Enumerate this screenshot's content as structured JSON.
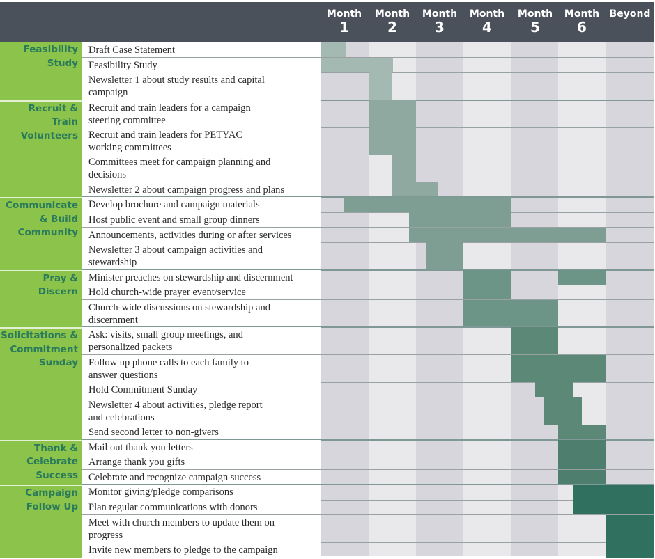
{
  "chart_data": {
    "type": "gantt",
    "title": "",
    "columns": [
      {
        "word": "Month",
        "num": "1"
      },
      {
        "word": "Month",
        "num": "2"
      },
      {
        "word": "Month",
        "num": "3"
      },
      {
        "word": "Month",
        "num": "4"
      },
      {
        "word": "Month",
        "num": "5"
      },
      {
        "word": "Month",
        "num": "6"
      },
      {
        "word": "Beyond",
        "num": ""
      }
    ],
    "x_unit": "months from campaign start (0 = start of Month 1, 6 = start of Beyond, 7 = end of Beyond)",
    "xlim": [
      0,
      7
    ],
    "groups": [
      {
        "label": "Feasibility Study",
        "color": "#a4b9b1",
        "tasks": [
          {
            "label": "Draft Case Statement",
            "spans": [
              [
                0,
                0.54
              ]
            ]
          },
          {
            "label": "Feasibility Study",
            "spans": [
              [
                0,
                1.52
              ]
            ]
          },
          {
            "label": "Newsletter 1 about study results and capital campaign",
            "spans": [
              [
                1.0,
                1.5
              ]
            ]
          }
        ]
      },
      {
        "label": "Recruit & Train Volunteers",
        "color": "#8fa9a1",
        "tasks": [
          {
            "label": "Recruit and train leaders for a campaign steering committee",
            "spans": [
              [
                1,
                2
              ]
            ]
          },
          {
            "label": "Recruit and train leaders for PETYAC working committees",
            "spans": [
              [
                1,
                2
              ]
            ]
          },
          {
            "label": "Committees meet for campaign planning and decisions",
            "spans": [
              [
                1.5,
                2
              ]
            ]
          },
          {
            "label": "Newsletter 2 about campaign progress and plans",
            "spans": [
              [
                1.5,
                2.45
              ]
            ]
          }
        ]
      },
      {
        "label": "Communicate & Build Community",
        "color": "#7e9e94",
        "tasks": [
          {
            "label": "Develop brochure and campaign materials",
            "spans": [
              [
                0.48,
                4
              ]
            ]
          },
          {
            "label": "Host public event and small group dinners",
            "spans": [
              [
                1.86,
                4
              ]
            ]
          },
          {
            "label": "Announcements, activities during or after services",
            "spans": [
              [
                1.86,
                6
              ]
            ]
          },
          {
            "label": "Newsletter 3 about campaign activities and stewardship",
            "spans": [
              [
                2.22,
                3
              ]
            ]
          }
        ]
      },
      {
        "label": "Pray & Discern",
        "color": "#6c9587",
        "tasks": [
          {
            "label": "Minister preaches on stewardship and discernment",
            "spans": [
              [
                3,
                4
              ],
              [
                5,
                6
              ]
            ]
          },
          {
            "label": "Hold church-wide prayer event/service",
            "spans": [
              [
                3,
                4
              ]
            ]
          },
          {
            "label": "Church-wide discussions on stewardship and discernment",
            "spans": [
              [
                3,
                5
              ]
            ]
          }
        ]
      },
      {
        "label": "Solicitations & Commitment Sunday",
        "color": "#5c8878",
        "tasks": [
          {
            "label": "Ask: visits, small group meetings, and personalized packets",
            "spans": [
              [
                4,
                5
              ]
            ]
          },
          {
            "label": "Follow up phone calls to each family to answer questions",
            "spans": [
              [
                4,
                6
              ]
            ]
          },
          {
            "label": "Hold Commitment Sunday",
            "spans": [
              [
                4.5,
                5.3
              ]
            ]
          },
          {
            "label": "Newsletter 4 about activities, pledge report and celebrations",
            "spans": [
              [
                4.7,
                5.5
              ]
            ]
          },
          {
            "label": "Send second letter to non-givers",
            "spans": [
              [
                5,
                6
              ]
            ]
          }
        ]
      },
      {
        "label": "Thank & Celebrate Success",
        "color": "#4e7f6e",
        "tasks": [
          {
            "label": "Mail out thank you letters",
            "spans": [
              [
                5,
                6
              ]
            ]
          },
          {
            "label": "Arrange thank you gifts",
            "spans": [
              [
                5,
                6
              ]
            ]
          },
          {
            "label": "Celebrate and recognize campaign success",
            "spans": [
              [
                5,
                6
              ]
            ]
          }
        ]
      },
      {
        "label": "Campaign Follow Up",
        "color": "#2f705f",
        "tasks": [
          {
            "label": "Monitor giving/pledge comparisons",
            "spans": [
              [
                5.3,
                7
              ]
            ]
          },
          {
            "label": "Plan regular communications with donors",
            "spans": [
              [
                5.3,
                7
              ]
            ]
          },
          {
            "label": "Meet with church members to update them on progress",
            "spans": [
              [
                6,
                7
              ]
            ]
          },
          {
            "label": "Invite new members to pledge to the campaign",
            "spans": [
              [
                6,
                7
              ]
            ]
          }
        ]
      }
    ]
  },
  "colors": {
    "header_bg": "#4a515b",
    "header_text": "#ffffff",
    "group_bg": "#8cc34a",
    "group_text": "#2a7a5c",
    "column_dark": "#d7d6dc",
    "column_light": "#e9e9ec"
  }
}
